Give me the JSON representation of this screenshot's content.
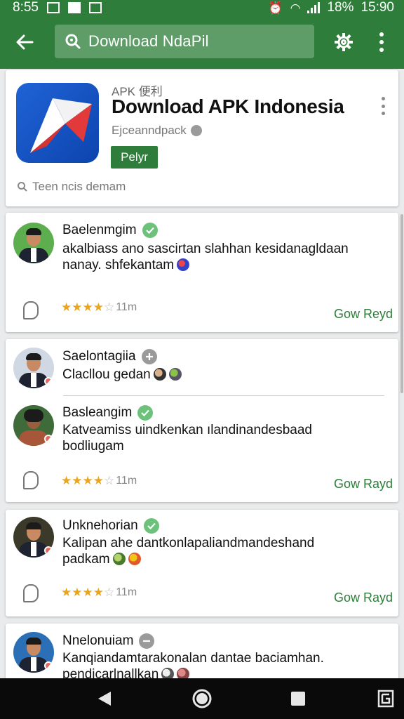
{
  "status_bar": {
    "time_left": "8:55",
    "battery": "18%",
    "time_right": "15:90"
  },
  "search": {
    "query": "Download NdaPil"
  },
  "icons": {
    "back": "arrow-left-icon",
    "search": "search-icon",
    "settings": "gear-icon",
    "overflow": "more-vert-icon",
    "comment": "comment-icon",
    "star": "star-icon",
    "globe": "globe-icon",
    "verified": "check-icon"
  },
  "colors": {
    "primary": "#2e7d3a",
    "accent_star": "#e9a51c",
    "verified": "#6cc27a"
  },
  "app": {
    "category": "APK 便利",
    "title": "Download APK Indonesia",
    "developer": "Ejceanndpack",
    "play_label": "Pelyr",
    "hint": "Teen ncis demam"
  },
  "reviews": [
    {
      "entries": [
        {
          "name": "Baelenmgim",
          "verified": true,
          "text_lines": [
            "akalbiass ano sascirtan slahhan kesidanagldaan",
            "nanay. shfekantam"
          ]
        }
      ],
      "rating": 4,
      "time": "11m",
      "reply_label": "Gow Reyd"
    },
    {
      "entries": [
        {
          "name": "Saelontagiia",
          "verified": false,
          "text_lines": [
            "Clacllou gedan"
          ]
        },
        {
          "name": "Basleangim",
          "verified": true,
          "text_lines": [
            "Katveamiss uindkenkan ılandinandesbaad",
            "bodliugam"
          ]
        }
      ],
      "rating": 4,
      "time": "11m",
      "reply_label": "Gow Rayd"
    },
    {
      "entries": [
        {
          "name": "Unknehorian",
          "verified": true,
          "text_lines": [
            "Kalipan ahe dantkonlapaliandmandeshand",
            "padkam"
          ]
        }
      ],
      "rating": 4,
      "time": "11m",
      "reply_label": "Gow Rayd"
    },
    {
      "entries": [
        {
          "name": "Nnelonuiam",
          "verified": false,
          "text_lines": [
            "Kanqiandamtarakonalan dantae baciamhan.",
            "pendicarlnallkan"
          ]
        }
      ]
    }
  ]
}
